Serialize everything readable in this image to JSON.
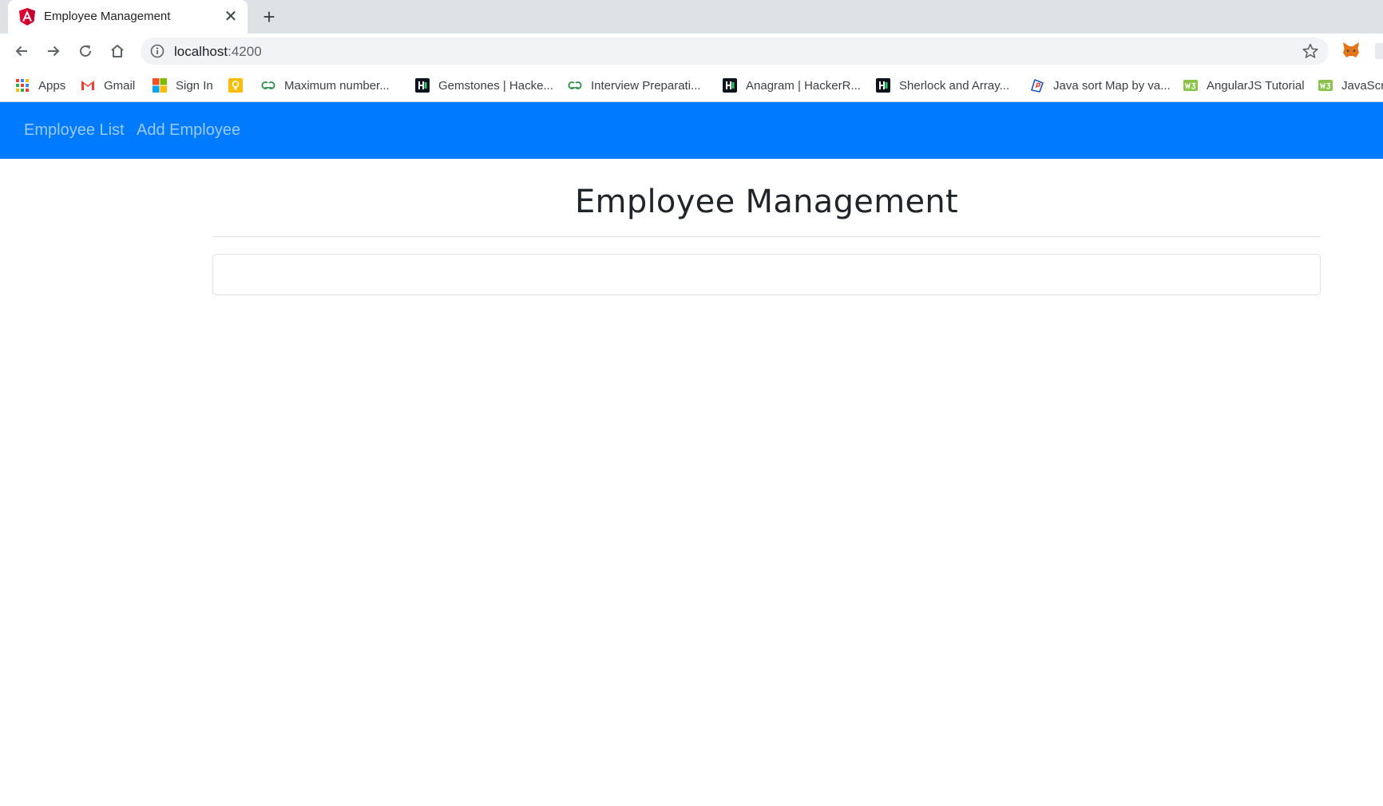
{
  "browser": {
    "tab": {
      "title": "Employee Management",
      "close_glyph": "✕",
      "favicon": "angular-logo-icon"
    },
    "new_tab_glyph": "+",
    "address": {
      "host": "localhost",
      "port": ":4200"
    },
    "bookmarks": [
      {
        "label": "Apps",
        "icon": "apps-grid-icon"
      },
      {
        "label": "Gmail",
        "icon": "gmail-icon"
      },
      {
        "label": "Sign In",
        "icon": "microsoft-icon"
      },
      {
        "label": "",
        "icon": "keep-icon"
      },
      {
        "label": "Maximum number...",
        "icon": "gfg-icon"
      },
      {
        "label": "Gemstones | Hacke...",
        "icon": "hackerrank-icon"
      },
      {
        "label": "Interview Preparati...",
        "icon": "gfg-icon"
      },
      {
        "label": "Anagram | HackerR...",
        "icon": "hackerrank-icon"
      },
      {
        "label": "Sherlock and Array...",
        "icon": "hackerrank-icon"
      },
      {
        "label": "Java sort Map by va...",
        "icon": "bookmark-p-icon"
      },
      {
        "label": "AngularJS Tutorial",
        "icon": "w3schools-icon"
      },
      {
        "label": "JavaScri",
        "icon": "w3schools-icon"
      }
    ]
  },
  "navbar": {
    "links": [
      "Employee List",
      "Add Employee"
    ],
    "color": "#007bff"
  },
  "main": {
    "title": "Employee Management"
  }
}
